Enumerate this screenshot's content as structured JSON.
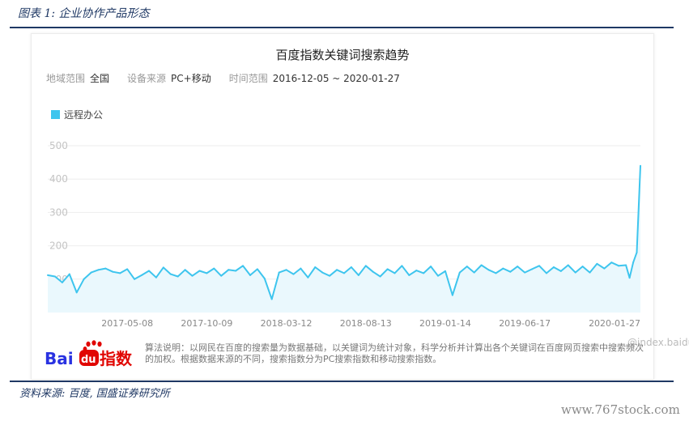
{
  "report": {
    "figure_caption": "图表 1:  企业协作产品形态",
    "source": "资料来源:  百度,  国盛证券研究所",
    "watermark": "www.767stock.com"
  },
  "card": {
    "filters": {
      "region_label": "地域范围",
      "region_value": "全国",
      "device_label": "设备来源",
      "device_value": "PC+移动",
      "time_label": "时间范围",
      "time_value": "2016-12-05 ~ 2020-01-27"
    },
    "attribution": "@index.baidu.com",
    "logo_text": {
      "bai": "Bai",
      "du": "du",
      "zhishu": "指数"
    },
    "note": "算法说明：以网民在百度的搜索量为数据基础，以关键词为统计对象，科学分析并计算出各个关键词在百度网页搜索中搜索频次的加权。根据数据来源的不同，搜索指数分为PC搜索指数和移动搜索指数。"
  },
  "colors": {
    "line": "#3ec5ee",
    "area": "#eaf8fd",
    "brand_red": "#e10602",
    "brand_blue": "#2932e1",
    "caption": "#1f3864"
  },
  "chart_data": {
    "type": "area",
    "title": "百度指数关键词搜索趋势",
    "series": [
      {
        "name": "远程办公",
        "x": [
          "2016-12-05",
          "2016-12-19",
          "2017-01-02",
          "2017-01-16",
          "2017-01-30",
          "2017-02-13",
          "2017-02-27",
          "2017-03-13",
          "2017-03-27",
          "2017-04-10",
          "2017-04-24",
          "2017-05-08",
          "2017-05-22",
          "2017-06-05",
          "2017-06-19",
          "2017-07-03",
          "2017-07-17",
          "2017-07-31",
          "2017-08-14",
          "2017-08-28",
          "2017-09-11",
          "2017-09-25",
          "2017-10-09",
          "2017-10-23",
          "2017-11-06",
          "2017-11-20",
          "2017-12-04",
          "2017-12-18",
          "2018-01-01",
          "2018-01-15",
          "2018-01-29",
          "2018-02-12",
          "2018-02-26",
          "2018-03-12",
          "2018-03-26",
          "2018-04-09",
          "2018-04-23",
          "2018-05-07",
          "2018-05-21",
          "2018-06-04",
          "2018-06-18",
          "2018-07-02",
          "2018-07-16",
          "2018-07-30",
          "2018-08-13",
          "2018-08-27",
          "2018-09-10",
          "2018-09-24",
          "2018-10-08",
          "2018-10-22",
          "2018-11-05",
          "2018-11-19",
          "2018-12-03",
          "2018-12-17",
          "2018-12-31",
          "2019-01-14",
          "2019-01-28",
          "2019-02-11",
          "2019-02-25",
          "2019-03-11",
          "2019-03-25",
          "2019-04-08",
          "2019-04-22",
          "2019-05-06",
          "2019-05-20",
          "2019-06-03",
          "2019-06-17",
          "2019-07-01",
          "2019-07-15",
          "2019-07-29",
          "2019-08-12",
          "2019-08-26",
          "2019-09-09",
          "2019-09-23",
          "2019-10-07",
          "2019-10-21",
          "2019-11-04",
          "2019-11-18",
          "2019-12-02",
          "2019-12-16",
          "2019-12-30",
          "2020-01-06",
          "2020-01-13",
          "2020-01-20",
          "2020-01-27"
        ],
        "values": [
          112,
          108,
          90,
          115,
          60,
          100,
          120,
          128,
          132,
          122,
          118,
          130,
          100,
          112,
          125,
          105,
          135,
          115,
          108,
          128,
          110,
          125,
          118,
          132,
          110,
          128,
          125,
          140,
          112,
          130,
          102,
          40,
          120,
          128,
          115,
          132,
          105,
          136,
          120,
          110,
          128,
          118,
          136,
          112,
          140,
          122,
          108,
          130,
          118,
          140,
          112,
          126,
          118,
          138,
          110,
          124,
          52,
          120,
          138,
          120,
          142,
          128,
          118,
          132,
          122,
          138,
          120,
          130,
          140,
          118,
          136,
          124,
          142,
          120,
          138,
          120,
          146,
          132,
          150,
          140,
          142,
          104,
          150,
          180,
          440
        ]
      }
    ],
    "xticks": [
      "2017-05-08",
      "2017-10-09",
      "2018-03-12",
      "2018-08-13",
      "2019-01-14",
      "2019-06-17",
      "2020-01-27"
    ],
    "yticks": [
      100,
      200,
      300,
      400,
      500
    ],
    "ylim": [
      0,
      500
    ],
    "grid": true,
    "legend": "top-left"
  }
}
